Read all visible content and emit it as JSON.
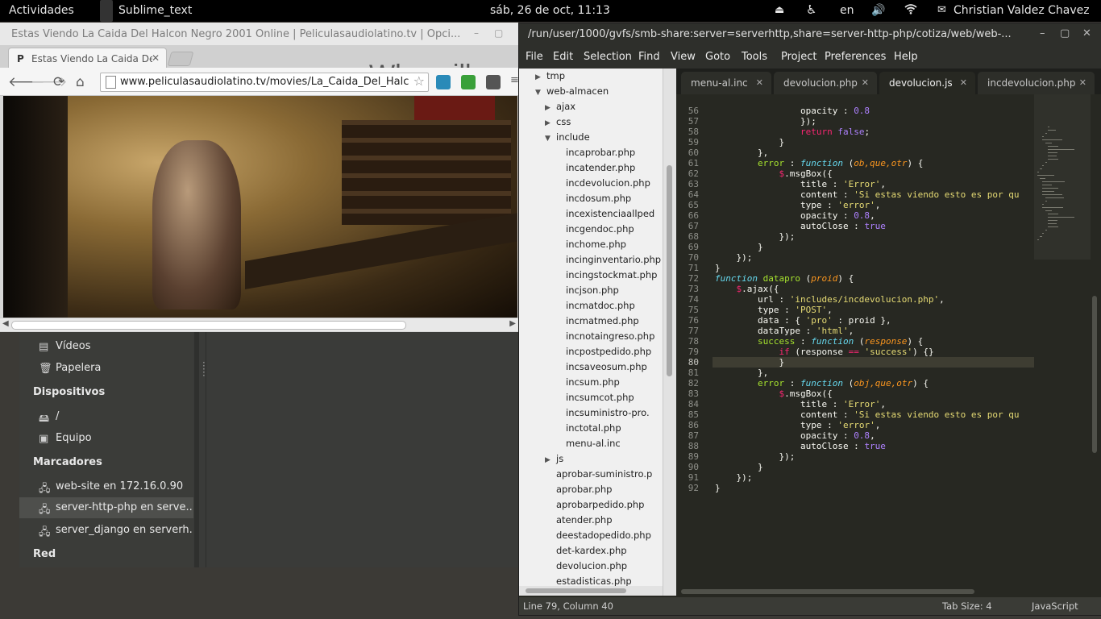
{
  "topbar": {
    "activities": "Actividades",
    "app_name": "Sublime_text",
    "datetime": "sáb, 26 de oct, 11:13",
    "lang": "en",
    "user": "Christian Valdez Chavez"
  },
  "chrome": {
    "window_title": "Estas Viendo La Caida Del Halcon Negro 2001 Online | Peliculasaudiolatino.tv | Opci...",
    "tab_title": "Estas Viendo La Caida Del Halcon Negro",
    "tab_favicon": "P",
    "overlay_text": "Who will w",
    "url": "www.peliculasaudiolatino.tv/movies/La_Caida_Del_Halcon"
  },
  "files": {
    "items_top": [
      {
        "icon": "video-icon",
        "label": "Vídeos"
      },
      {
        "icon": "trash-icon",
        "label": "Papelera"
      }
    ],
    "devices_header": "Dispositivos",
    "devices": [
      {
        "icon": "drive-icon",
        "label": "/"
      },
      {
        "icon": "computer-icon",
        "label": "Equipo"
      }
    ],
    "bookmarks_header": "Marcadores",
    "bookmarks": [
      {
        "icon": "network-folder-icon",
        "label": "web-site en 172.16.0.90"
      },
      {
        "icon": "network-folder-icon",
        "label": "server-http-php en serve..."
      },
      {
        "icon": "network-folder-icon",
        "label": "server_django en serverh..."
      }
    ],
    "network_header": "Red"
  },
  "sublime": {
    "window_title": "/run/user/1000/gvfs/smb-share:server=serverhttp,share=server-http-php/cotiza/web/web-...",
    "menu": [
      "File",
      "Edit",
      "Selection",
      "Find",
      "View",
      "Goto",
      "Tools",
      "Project",
      "Preferences",
      "Help"
    ],
    "tabs": [
      {
        "label": "menu-al.inc",
        "active": false
      },
      {
        "label": "devolucion.php",
        "active": false
      },
      {
        "label": "devolucion.js",
        "active": true
      },
      {
        "label": "incdevolucion.php",
        "active": false
      }
    ],
    "tree": [
      {
        "depth": 0,
        "arrow": "right",
        "label": "tmp"
      },
      {
        "depth": 0,
        "arrow": "down",
        "label": "web-almacen"
      },
      {
        "depth": 1,
        "arrow": "right",
        "label": "ajax"
      },
      {
        "depth": 1,
        "arrow": "right",
        "label": "css"
      },
      {
        "depth": 1,
        "arrow": "down",
        "label": "include"
      },
      {
        "depth": 2,
        "arrow": "",
        "label": "incaprobar.php"
      },
      {
        "depth": 2,
        "arrow": "",
        "label": "incatender.php"
      },
      {
        "depth": 2,
        "arrow": "",
        "label": "incdevolucion.php"
      },
      {
        "depth": 2,
        "arrow": "",
        "label": "incdosum.php"
      },
      {
        "depth": 2,
        "arrow": "",
        "label": "incexistenciaallped"
      },
      {
        "depth": 2,
        "arrow": "",
        "label": "incgendoc.php"
      },
      {
        "depth": 2,
        "arrow": "",
        "label": "inchome.php"
      },
      {
        "depth": 2,
        "arrow": "",
        "label": "incinginventario.php"
      },
      {
        "depth": 2,
        "arrow": "",
        "label": "incingstockmat.php"
      },
      {
        "depth": 2,
        "arrow": "",
        "label": "incjson.php"
      },
      {
        "depth": 2,
        "arrow": "",
        "label": "incmatdoc.php"
      },
      {
        "depth": 2,
        "arrow": "",
        "label": "incmatmed.php"
      },
      {
        "depth": 2,
        "arrow": "",
        "label": "incnotaingreso.php"
      },
      {
        "depth": 2,
        "arrow": "",
        "label": "incpostpedido.php"
      },
      {
        "depth": 2,
        "arrow": "",
        "label": "incsaveosum.php"
      },
      {
        "depth": 2,
        "arrow": "",
        "label": "incsum.php"
      },
      {
        "depth": 2,
        "arrow": "",
        "label": "incsumcot.php"
      },
      {
        "depth": 2,
        "arrow": "",
        "label": "incsuministro-pro."
      },
      {
        "depth": 2,
        "arrow": "",
        "label": "inctotal.php"
      },
      {
        "depth": 2,
        "arrow": "",
        "label": "menu-al.inc"
      },
      {
        "depth": 1,
        "arrow": "right",
        "label": "js"
      },
      {
        "depth": 1,
        "arrow": "",
        "label": "aprobar-suministro.p"
      },
      {
        "depth": 1,
        "arrow": "",
        "label": "aprobar.php"
      },
      {
        "depth": 1,
        "arrow": "",
        "label": "aprobarpedido.php"
      },
      {
        "depth": 1,
        "arrow": "",
        "label": "atender.php"
      },
      {
        "depth": 1,
        "arrow": "",
        "label": "deestadopedido.php"
      },
      {
        "depth": 1,
        "arrow": "",
        "label": "det-kardex.php"
      },
      {
        "depth": 1,
        "arrow": "",
        "label": "devolucion.php"
      },
      {
        "depth": 1,
        "arrow": "",
        "label": "estadisticas.php"
      }
    ],
    "current_line": 80,
    "code": [
      {
        "n": 57,
        "t": [
          [
            "",
            "                });"
          ]
        ]
      },
      {
        "n": 58,
        "t": [
          [
            "",
            "                "
          ],
          [
            "kw",
            "return"
          ],
          [
            "",
            " "
          ],
          [
            "nm",
            "false"
          ],
          [
            "",
            ";"
          ]
        ]
      },
      {
        "n": 59,
        "t": [
          [
            "",
            "            }"
          ]
        ]
      },
      {
        "n": 60,
        "t": [
          [
            "",
            "        },"
          ]
        ]
      },
      {
        "n": 61,
        "t": [
          [
            "",
            "        "
          ],
          [
            "gn",
            "error"
          ],
          [
            "",
            " : "
          ],
          [
            "fn",
            "function"
          ],
          [
            "",
            " ("
          ],
          [
            "pr",
            "ob,que,otr"
          ],
          [
            "",
            ") {"
          ]
        ]
      },
      {
        "n": 62,
        "t": [
          [
            "",
            "            "
          ],
          [
            "kw",
            "$"
          ],
          [
            "",
            ".msgBox({"
          ]
        ]
      },
      {
        "n": 63,
        "t": [
          [
            "",
            "                title : "
          ],
          [
            "st",
            "'Error'"
          ],
          [
            "",
            ","
          ]
        ]
      },
      {
        "n": 64,
        "t": [
          [
            "",
            "                content : "
          ],
          [
            "st",
            "'Si estas viendo esto es por qu"
          ]
        ]
      },
      {
        "n": 65,
        "t": [
          [
            "",
            "                type : "
          ],
          [
            "st",
            "'error'"
          ],
          [
            "",
            ","
          ]
        ]
      },
      {
        "n": 66,
        "t": [
          [
            "",
            "                opacity : "
          ],
          [
            "nm",
            "0.8"
          ],
          [
            "",
            ","
          ]
        ]
      },
      {
        "n": 67,
        "t": [
          [
            "",
            "                autoClose : "
          ],
          [
            "nm",
            "true"
          ]
        ]
      },
      {
        "n": 68,
        "t": [
          [
            "",
            "            });"
          ]
        ]
      },
      {
        "n": 69,
        "t": [
          [
            "",
            "        }"
          ]
        ]
      },
      {
        "n": 70,
        "t": [
          [
            "",
            "    });"
          ]
        ]
      },
      {
        "n": 71,
        "t": [
          [
            "",
            "}"
          ]
        ]
      },
      {
        "n": 72,
        "t": [
          [
            "fn",
            "function"
          ],
          [
            "",
            " "
          ],
          [
            "gn",
            "datapro"
          ],
          [
            "",
            " ("
          ],
          [
            "pr",
            "proid"
          ],
          [
            "",
            ") {"
          ]
        ]
      },
      {
        "n": 73,
        "t": [
          [
            "",
            "    "
          ],
          [
            "kw",
            "$"
          ],
          [
            "",
            ".ajax({"
          ]
        ]
      },
      {
        "n": 74,
        "t": [
          [
            "",
            "        url : "
          ],
          [
            "st",
            "'includes/incdevolucion.php'"
          ],
          [
            "",
            ","
          ]
        ]
      },
      {
        "n": 75,
        "t": [
          [
            "",
            "        type : "
          ],
          [
            "st",
            "'POST'"
          ],
          [
            "",
            ","
          ]
        ]
      },
      {
        "n": 76,
        "t": [
          [
            "",
            "        data : { "
          ],
          [
            "st",
            "'pro'"
          ],
          [
            "",
            " : proid },"
          ]
        ]
      },
      {
        "n": 77,
        "t": [
          [
            "",
            "        dataType : "
          ],
          [
            "st",
            "'html'"
          ],
          [
            "",
            ","
          ]
        ]
      },
      {
        "n": 78,
        "t": [
          [
            "",
            "        "
          ],
          [
            "gn",
            "success"
          ],
          [
            "",
            " : "
          ],
          [
            "fn",
            "function"
          ],
          [
            "",
            " ("
          ],
          [
            "pr",
            "response"
          ],
          [
            "",
            ") {"
          ]
        ]
      },
      {
        "n": 79,
        "t": [
          [
            "",
            "            "
          ],
          [
            "kw",
            "if"
          ],
          [
            "",
            " (response "
          ],
          [
            "kw",
            "=="
          ],
          [
            "",
            " "
          ],
          [
            "st",
            "'success'"
          ],
          [
            "",
            ") {}"
          ]
        ]
      },
      {
        "n": 80,
        "t": [
          [
            "",
            "            }"
          ]
        ]
      },
      {
        "n": 81,
        "t": [
          [
            "",
            "        },"
          ]
        ]
      },
      {
        "n": 82,
        "t": [
          [
            "",
            "        "
          ],
          [
            "gn",
            "error"
          ],
          [
            "",
            " : "
          ],
          [
            "fn",
            "function"
          ],
          [
            "",
            " ("
          ],
          [
            "pr",
            "obj,que,otr"
          ],
          [
            "",
            ") {"
          ]
        ]
      },
      {
        "n": 83,
        "t": [
          [
            "",
            "            "
          ],
          [
            "kw",
            "$"
          ],
          [
            "",
            ".msgBox({"
          ]
        ]
      },
      {
        "n": 84,
        "t": [
          [
            "",
            "                title : "
          ],
          [
            "st",
            "'Error'"
          ],
          [
            "",
            ","
          ]
        ]
      },
      {
        "n": 85,
        "t": [
          [
            "",
            "                content : "
          ],
          [
            "st",
            "'Si estas viendo esto es por qu"
          ]
        ]
      },
      {
        "n": 86,
        "t": [
          [
            "",
            "                type : "
          ],
          [
            "st",
            "'error'"
          ],
          [
            "",
            ","
          ]
        ]
      },
      {
        "n": 87,
        "t": [
          [
            "",
            "                opacity : "
          ],
          [
            "nm",
            "0.8"
          ],
          [
            "",
            ","
          ]
        ]
      },
      {
        "n": 88,
        "t": [
          [
            "",
            "                autoClose : "
          ],
          [
            "nm",
            "true"
          ]
        ]
      },
      {
        "n": 89,
        "t": [
          [
            "",
            "            });"
          ]
        ]
      },
      {
        "n": 90,
        "t": [
          [
            "",
            "        }"
          ]
        ]
      },
      {
        "n": 91,
        "t": [
          [
            "",
            "    });"
          ]
        ]
      },
      {
        "n": 92,
        "t": [
          [
            "",
            "}"
          ]
        ]
      }
    ],
    "status_left": "Line 79, Column 40",
    "tab_size": "Tab Size: 4",
    "syntax": "JavaScript"
  }
}
